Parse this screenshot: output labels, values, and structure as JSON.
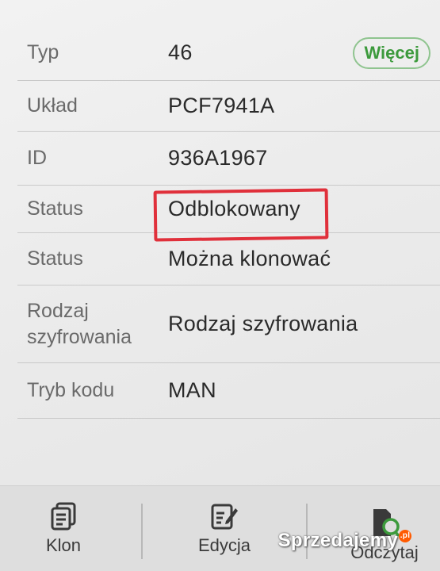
{
  "rows": [
    {
      "label": "Typ",
      "value": "46"
    },
    {
      "label": "Układ",
      "value": "PCF7941A"
    },
    {
      "label": "ID",
      "value": "936A1967"
    },
    {
      "label": "Status",
      "value": "Odblokowany"
    },
    {
      "label": "Status",
      "value": "Można klonować"
    },
    {
      "label_line1": "Rodzaj",
      "label_line2": "szyfrowania",
      "value": "Rodzaj szyfrowania"
    },
    {
      "label": "Tryb kodu",
      "value": "MAN"
    }
  ],
  "more_button": "Więcej",
  "bottom_nav": [
    {
      "label": "Klon",
      "icon": "copy-icon"
    },
    {
      "label": "Edycja",
      "icon": "edit-icon"
    },
    {
      "label": "Odczytaj",
      "icon": "read-key-icon"
    }
  ],
  "watermark": {
    "text": "Sprzedajemy",
    "suffix": ".pl"
  },
  "colors": {
    "accent_green": "#3c9a3c",
    "highlight_red": "#e0303b",
    "label_gray": "#6a6a6a"
  }
}
